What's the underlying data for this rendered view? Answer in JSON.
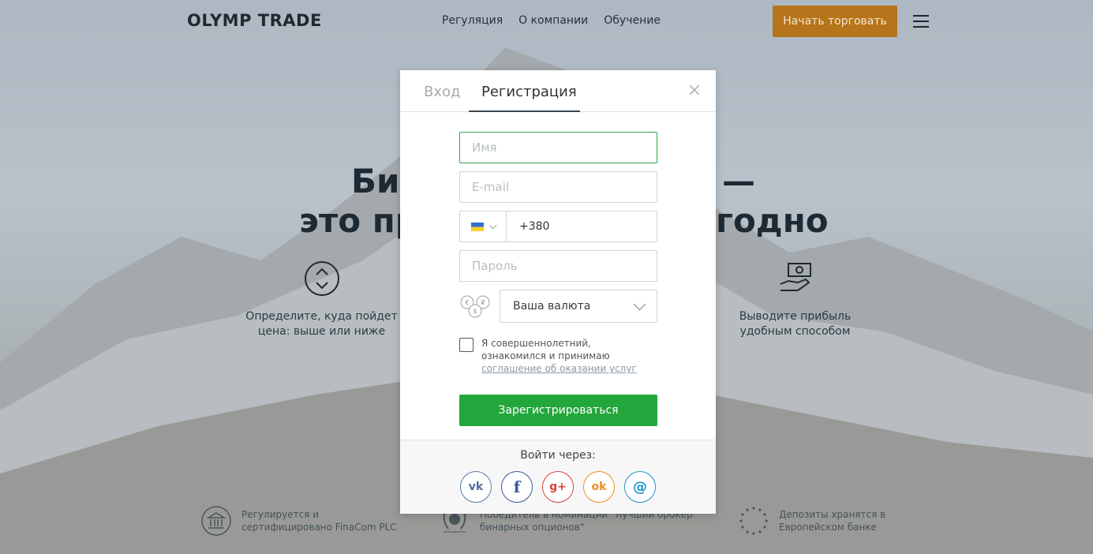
{
  "header": {
    "logo": "OLYMP TRADE",
    "nav": [
      "Регуляция",
      "О компании",
      "Обучение"
    ],
    "cta_label": "Начать торговать"
  },
  "hero": {
    "line1_left": "Би",
    "line1_right": "—",
    "line2_left": "это пр",
    "line2_right": "годно"
  },
  "features": [
    {
      "text": "Определите, куда пойдет цена: выше или ниже"
    },
    {
      "text": "Выводите прибыль удобным способом"
    }
  ],
  "footer": [
    {
      "text": "Регулируется и сертифицировано FinaCom PLC"
    },
    {
      "text": "Победитель в номинации \"Лучший брокер бинарных опционов\""
    },
    {
      "text": "Депозиты хранятся в Европейском банке"
    }
  ],
  "modal": {
    "tab_login": "Вход",
    "tab_register": "Регистрация",
    "close": "×",
    "name_placeholder": "Имя",
    "email_placeholder": "E-mail",
    "phone_code": "+380",
    "password_placeholder": "Пароль",
    "currency_placeholder": "Ваша валюта",
    "agree_text": "Я совершеннолетний, ознакомился и принимаю",
    "agree_link": "соглашение об оказании услуг",
    "submit_label": "Зарегистрироваться",
    "social_title": "Войти через:",
    "social": [
      "vk",
      "f",
      "g+",
      "ok",
      "@"
    ]
  }
}
